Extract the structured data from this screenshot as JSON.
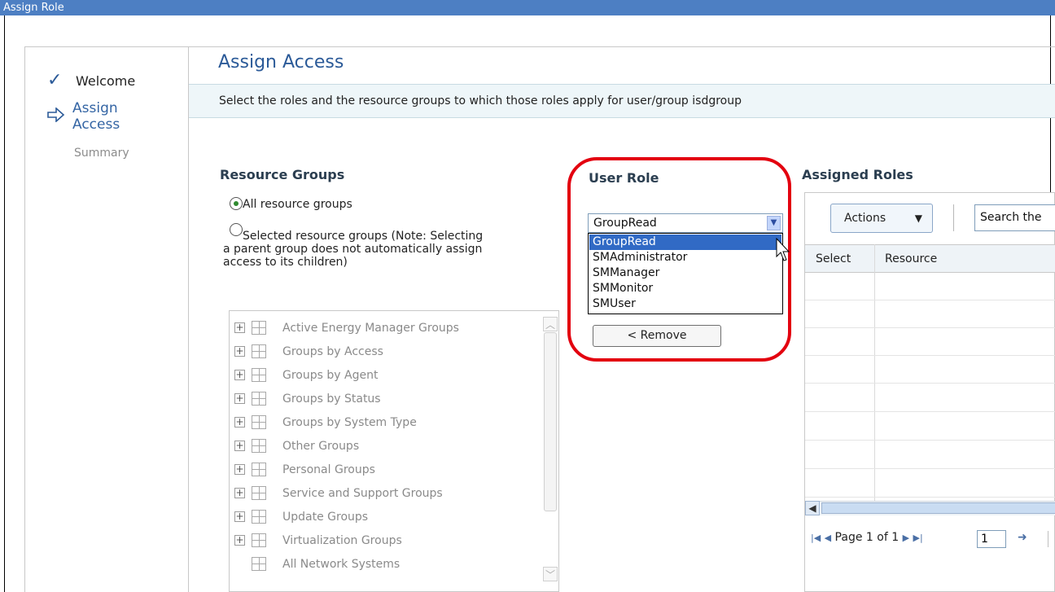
{
  "window": {
    "title": "Assign Role"
  },
  "wizard": {
    "steps": [
      {
        "label": "Welcome",
        "status": "complete",
        "icon": "checkmark-icon"
      },
      {
        "label_line1": "Assign",
        "label_line2": "Access",
        "status": "current",
        "icon": "arrow-right-icon"
      },
      {
        "label": "Summary",
        "status": "pending"
      }
    ]
  },
  "main": {
    "title": "Assign Access",
    "description": "Select the roles and the resource groups to which those roles apply for user/group isdgroup"
  },
  "resource_groups": {
    "heading": "Resource Groups",
    "option_all": "All resource groups",
    "option_selected_line1": "Selected resource groups (Note: Selecting",
    "option_selected_line2": "a parent group does not automatically assign",
    "option_selected_line3": "access to its children)",
    "selected_option": "all",
    "tree_items": [
      {
        "label": "Active Energy Manager Groups",
        "expandable": true
      },
      {
        "label": "Groups by Access",
        "expandable": true
      },
      {
        "label": "Groups by Agent",
        "expandable": true
      },
      {
        "label": "Groups by Status",
        "expandable": true
      },
      {
        "label": "Groups by System Type",
        "expandable": true
      },
      {
        "label": "Other Groups",
        "expandable": true
      },
      {
        "label": "Personal Groups",
        "expandable": true
      },
      {
        "label": "Service and Support Groups",
        "expandable": true
      },
      {
        "label": "Update Groups",
        "expandable": true
      },
      {
        "label": "Virtualization Groups",
        "expandable": true
      },
      {
        "label": "All Network Systems",
        "expandable": false
      }
    ]
  },
  "user_role": {
    "heading": "User Role",
    "selected": "GroupRead",
    "options": [
      "GroupRead",
      "SMAdministrator",
      "SMManager",
      "SMMonitor",
      "SMUser"
    ],
    "remove_label": "< Remove"
  },
  "assigned_roles": {
    "heading": "Assigned Roles",
    "actions_label": "Actions",
    "search_placeholder": "Search the",
    "columns": [
      "Select",
      "Resource"
    ],
    "pager": {
      "label": "Page 1 of 1",
      "page_value": "1"
    }
  },
  "colors": {
    "title_bar": "#4d7fc3",
    "accent": "#2b5a98",
    "highlight": "#e3000f",
    "dropdown_selected": "#316ac5"
  }
}
